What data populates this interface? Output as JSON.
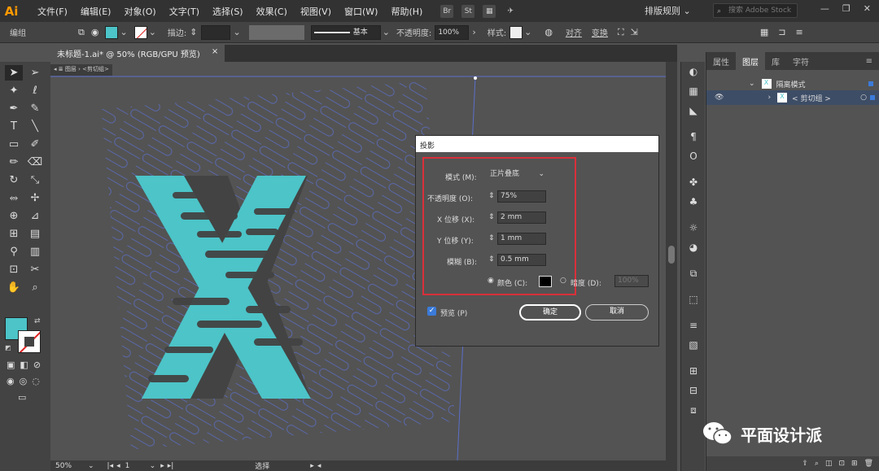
{
  "app": {
    "logo": "Ai"
  },
  "menu": [
    "文件(F)",
    "编辑(E)",
    "对象(O)",
    "文字(T)",
    "选择(S)",
    "效果(C)",
    "视图(V)",
    "窗口(W)",
    "帮助(H)"
  ],
  "menubar_icons": [
    "Br",
    "St"
  ],
  "workspace": "排版规则",
  "stock_search_placeholder": "搜索 Adobe Stock",
  "control": {
    "group_label": "编组",
    "stroke_label": "描边:",
    "stroke_style": "基本",
    "opacity_label": "不透明度:",
    "opacity_value": "100%",
    "style_label": "样式:",
    "align_label": "对齐",
    "transform_label": "变换"
  },
  "document_tab": {
    "title": "未标题-1.ai* @ 50% (RGB/GPU 预览)",
    "close": "×"
  },
  "breadcrumb": {
    "layer": "图层",
    "group": "<剪切组>"
  },
  "status": {
    "zoom": "50%",
    "page": "1",
    "mode": "选择"
  },
  "panel": {
    "tabs": [
      "属性",
      "图层",
      "库",
      "字符"
    ],
    "active_tab": "图层",
    "layers": [
      {
        "name": "隔离模式"
      },
      {
        "name": "< 剪切组 >"
      }
    ]
  },
  "dialog": {
    "title": "投影",
    "mode_label": "模式 (M):",
    "mode_value": "正片叠底",
    "opacity_label": "不透明度 (O):",
    "opacity_value": "75%",
    "x_offset_label": "X 位移 (X):",
    "x_offset_value": "2 mm",
    "y_offset_label": "Y 位移 (Y):",
    "y_offset_value": "1 mm",
    "blur_label": "模糊 (B):",
    "blur_value": "0.5 mm",
    "color_label": "颜色 (C):",
    "darkness_label": "暗度 (D):",
    "darkness_value": "100%",
    "preview_label": "预览 (P)",
    "preview_checked": true,
    "ok_label": "确定",
    "cancel_label": "取消"
  },
  "colors": {
    "fill": "#4cc4c8",
    "artwork_dark": "#434343",
    "red_highlight": "#d9303a",
    "guide_lines": "#5b6fc9"
  },
  "watermark": "平面设计派"
}
